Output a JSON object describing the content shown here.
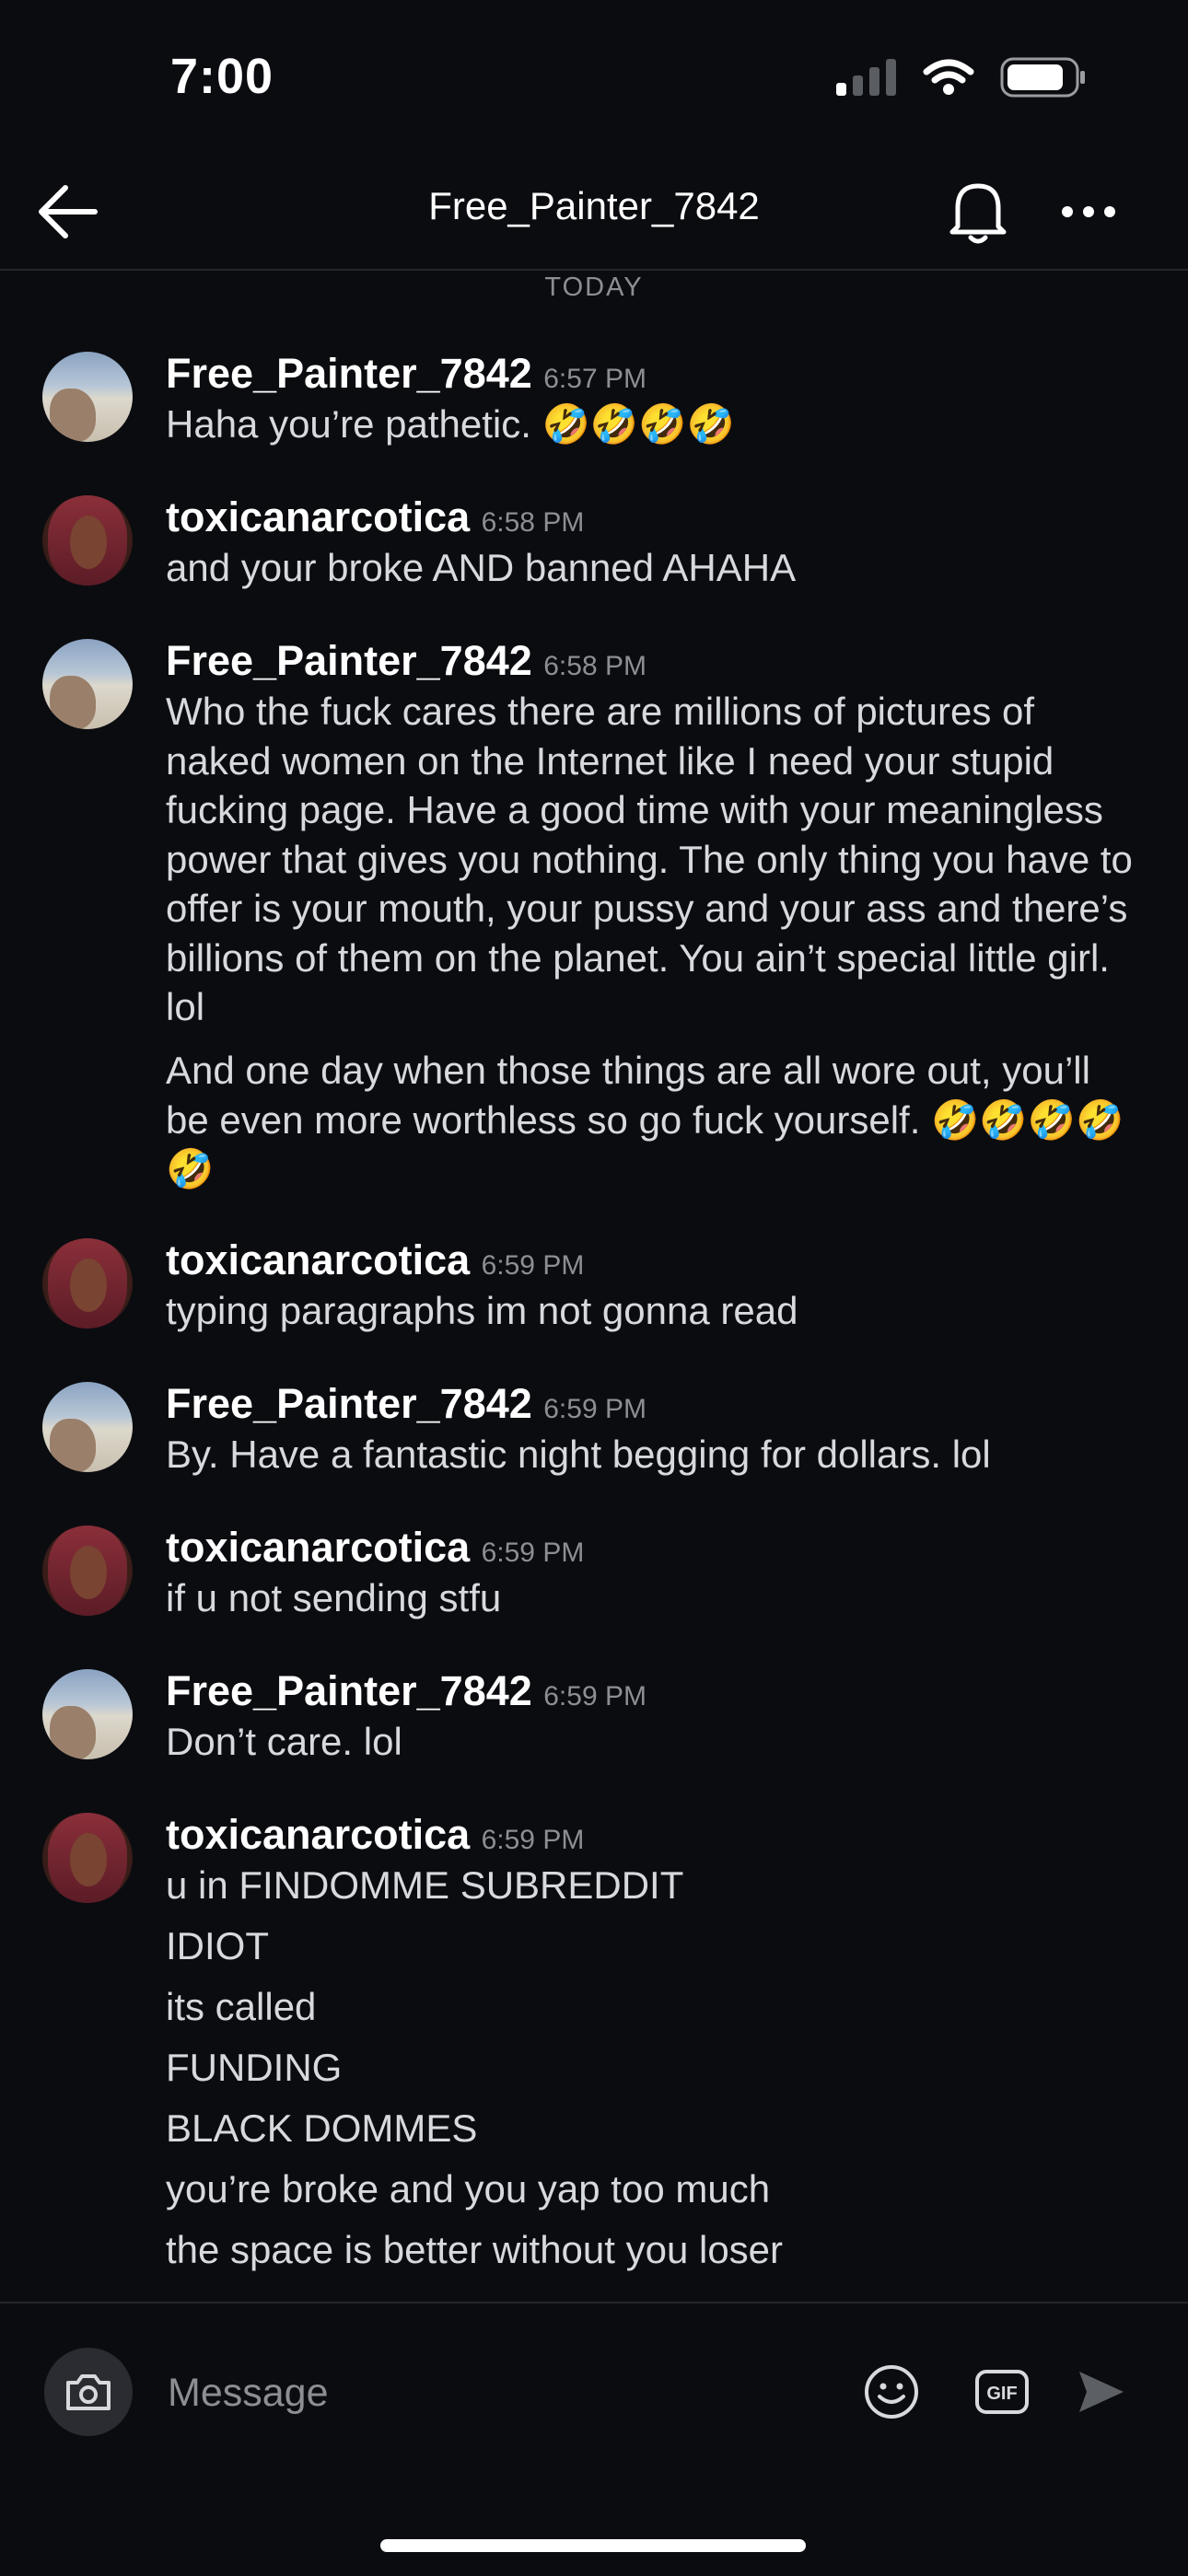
{
  "status_bar": {
    "time": "7:00"
  },
  "header": {
    "title": "Free_Painter_7842"
  },
  "date_divider": "TODAY",
  "messages": [
    {
      "user": "Free_Painter_7842",
      "time": "6:57 PM",
      "avatar": "painter",
      "lines": [
        "Haha you’re pathetic. 🤣🤣🤣🤣"
      ]
    },
    {
      "user": "toxicanarcotica",
      "time": "6:58 PM",
      "avatar": "toxic",
      "lines": [
        "and your broke AND banned AHAHA"
      ]
    },
    {
      "user": "Free_Painter_7842",
      "time": "6:58 PM",
      "avatar": "painter",
      "lines": [
        "Who the fuck cares there are millions of pictures of naked women on the Internet like I need your stupid fucking page. Have a good time with your meaningless power that gives you nothing. The only thing you have to offer is your mouth, your pussy and your ass and there’s billions of them on the planet. You ain’t special little girl. lol",
        "And one day when those things are all wore out, you’ll be even more worthless so go fuck yourself. 🤣🤣🤣🤣🤣"
      ]
    },
    {
      "user": "toxicanarcotica",
      "time": "6:59 PM",
      "avatar": "toxic",
      "lines": [
        "typing paragraphs im not gonna read"
      ]
    },
    {
      "user": "Free_Painter_7842",
      "time": "6:59 PM",
      "avatar": "painter",
      "lines": [
        "By. Have a fantastic night begging for dollars. lol"
      ]
    },
    {
      "user": "toxicanarcotica",
      "time": "6:59 PM",
      "avatar": "toxic",
      "lines": [
        "if u not sending stfu"
      ]
    },
    {
      "user": "Free_Painter_7842",
      "time": "6:59 PM",
      "avatar": "painter",
      "lines": [
        "Don’t care. lol"
      ]
    },
    {
      "user": "toxicanarcotica",
      "time": "6:59 PM",
      "avatar": "toxic",
      "lines": [
        "u in FINDOMME SUBREDDIT",
        "IDIOT",
        "its called",
        "FUNDING",
        "BLACK DOMMES",
        "you’re broke and you yap too much",
        "the space is better without you loser"
      ]
    }
  ],
  "composer": {
    "placeholder": "Message",
    "gif_label": "GIF"
  },
  "icons": {
    "back": "arrow-left-icon",
    "bell": "bell-icon",
    "more": "more-horizontal-icon",
    "camera": "camera-icon",
    "emoji": "smiley-icon",
    "gif": "gif-icon",
    "send": "send-icon",
    "signal": "signal-icon",
    "wifi": "wifi-icon",
    "battery": "battery-icon"
  },
  "colors": {
    "background": "#0b0c10",
    "text": "#d7dadc",
    "muted": "#8b8f94",
    "username": "#ffffff"
  }
}
